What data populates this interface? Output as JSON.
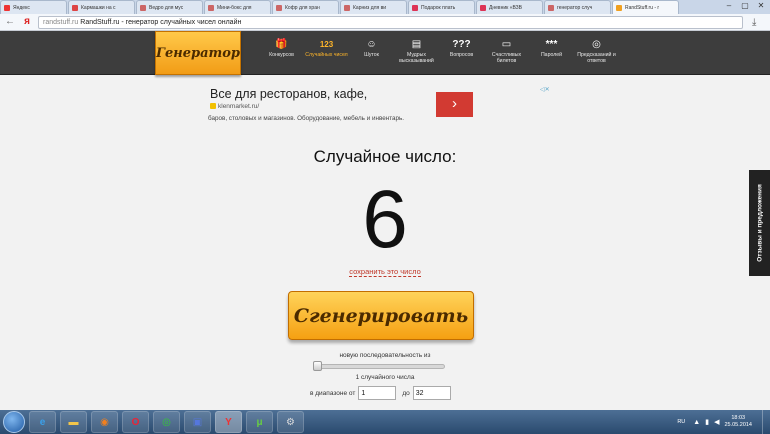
{
  "browser": {
    "tabs": [
      {
        "label": "Яндекс",
        "color": "#e33"
      },
      {
        "label": "Кармашки на с",
        "color": "#d44"
      },
      {
        "label": "Ведро для мус",
        "color": "#c66"
      },
      {
        "label": "Мини-бокс для",
        "color": "#c66"
      },
      {
        "label": "Кофр для хран",
        "color": "#c66"
      },
      {
        "label": "Карниз для ви",
        "color": "#c66"
      },
      {
        "label": "Подарок плать",
        "color": "#d35"
      },
      {
        "label": "Дневник «ВЗВ",
        "color": "#d35"
      },
      {
        "label": "генератор случ",
        "color": "#c66"
      },
      {
        "label": "RandStuff.ru - г",
        "color": "#f0a020"
      }
    ],
    "window_controls": {
      "minimize": "–",
      "maximize": "▢",
      "close": "✕"
    },
    "back_icon": "←",
    "nav_icon": "я",
    "url_host": "randstuff.ru",
    "url_rest": "RandStuff.ru - генератор случайных чисел онлайн",
    "download_icon": "⤓"
  },
  "site": {
    "logo": "Генератор",
    "nav": [
      {
        "icon": "🎁",
        "label": "Конкурсов",
        "active": false
      },
      {
        "icon": "123",
        "label": "Случайных чисел",
        "active": true
      },
      {
        "icon": "☺",
        "label": "Шуток",
        "active": false
      },
      {
        "icon": "▤",
        "label": "Мудрых высказываний",
        "active": false
      },
      {
        "icon": "???",
        "label": "Вопросов",
        "active": false
      },
      {
        "icon": "▭",
        "label": "Счастливых билетов",
        "active": false
      },
      {
        "icon": "***",
        "label": "Паролей",
        "active": false
      },
      {
        "icon": "◎",
        "label": "Предсказаний и ответов",
        "active": false
      }
    ]
  },
  "ad": {
    "headline": "Все для ресторанов, кафе,",
    "url": "klenmarket.ru/",
    "description": "баров, столовых и магазинов. Оборудование, мебель и инвентарь.",
    "arrow": "›",
    "choices": "◁✕"
  },
  "main": {
    "title": "Случайное число:",
    "number": "6",
    "save_link": "сохранить это число",
    "generate_button": "Сгенерировать",
    "sequence_label": "новую последовательность из",
    "sequence_count": "1 случайного числа",
    "sequence_fraction": 0.0,
    "range_from_label": "в диапазоне от",
    "range_from": "1",
    "range_to_label": "до",
    "range_to": "32"
  },
  "feedback_tab": "Отзывы и предложения",
  "taskbar": {
    "apps": [
      {
        "name": "internet-explorer-icon",
        "glyph": "e",
        "color": "#3aa0ea"
      },
      {
        "name": "file-explorer-icon",
        "glyph": "▬",
        "color": "#f1c54a"
      },
      {
        "name": "firefox-icon",
        "glyph": "◉",
        "color": "#f08020"
      },
      {
        "name": "opera-icon",
        "glyph": "O",
        "color": "#e23"
      },
      {
        "name": "chrome-icon",
        "glyph": "◎",
        "color": "#3c3"
      },
      {
        "name": "save-app-icon",
        "glyph": "▣",
        "color": "#5577dd"
      },
      {
        "name": "yandex-browser-icon",
        "glyph": "Y",
        "color": "#e33"
      },
      {
        "name": "utorrent-icon",
        "glyph": "μ",
        "color": "#6c4"
      },
      {
        "name": "settings-app-icon",
        "glyph": "⚙",
        "color": "#ddd"
      }
    ],
    "active_index": 6,
    "lang": "RU",
    "time": "18:03",
    "date": "25.05.2014"
  }
}
